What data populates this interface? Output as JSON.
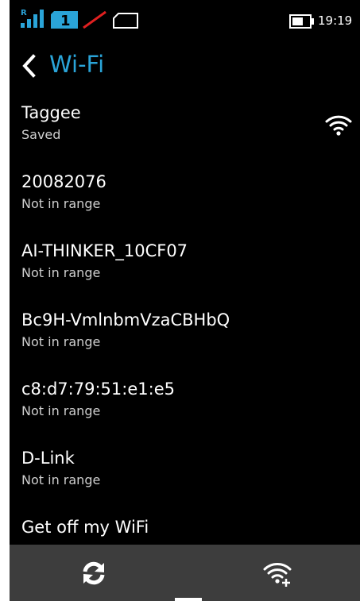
{
  "status_bar": {
    "network_indicator": "R",
    "sim_slot": "1",
    "time": "19:19",
    "icons": [
      "signal-strength-icon",
      "sim-card-icon",
      "no-data-icon",
      "mobile-data-icon",
      "battery-icon"
    ]
  },
  "header": {
    "title": "Wi-Fi",
    "back_icon": "chevron-left-icon"
  },
  "networks": [
    {
      "name": "Taggee",
      "status": "Saved",
      "icon": "wifi-full-icon"
    },
    {
      "name": "20082076",
      "status": "Not in range"
    },
    {
      "name": "AI-THINKER_10CF07",
      "status": "Not in range"
    },
    {
      "name": "Bc9H-VmlnbmVzaCBHbQ",
      "status": "Not in range"
    },
    {
      "name": "c8:d7:79:51:e1:e5",
      "status": "Not in range"
    },
    {
      "name": "D-Link",
      "status": "Not in range"
    },
    {
      "name": "Get off my WiFi",
      "status": ""
    }
  ],
  "toolbar": {
    "refresh_icon": "refresh-icon",
    "add_network_icon": "add-wifi-icon"
  },
  "colors": {
    "background": "#000000",
    "accent": "#2aa4d8",
    "toolbar": "#3d3d3d",
    "no_data_slash": "#e02020"
  }
}
